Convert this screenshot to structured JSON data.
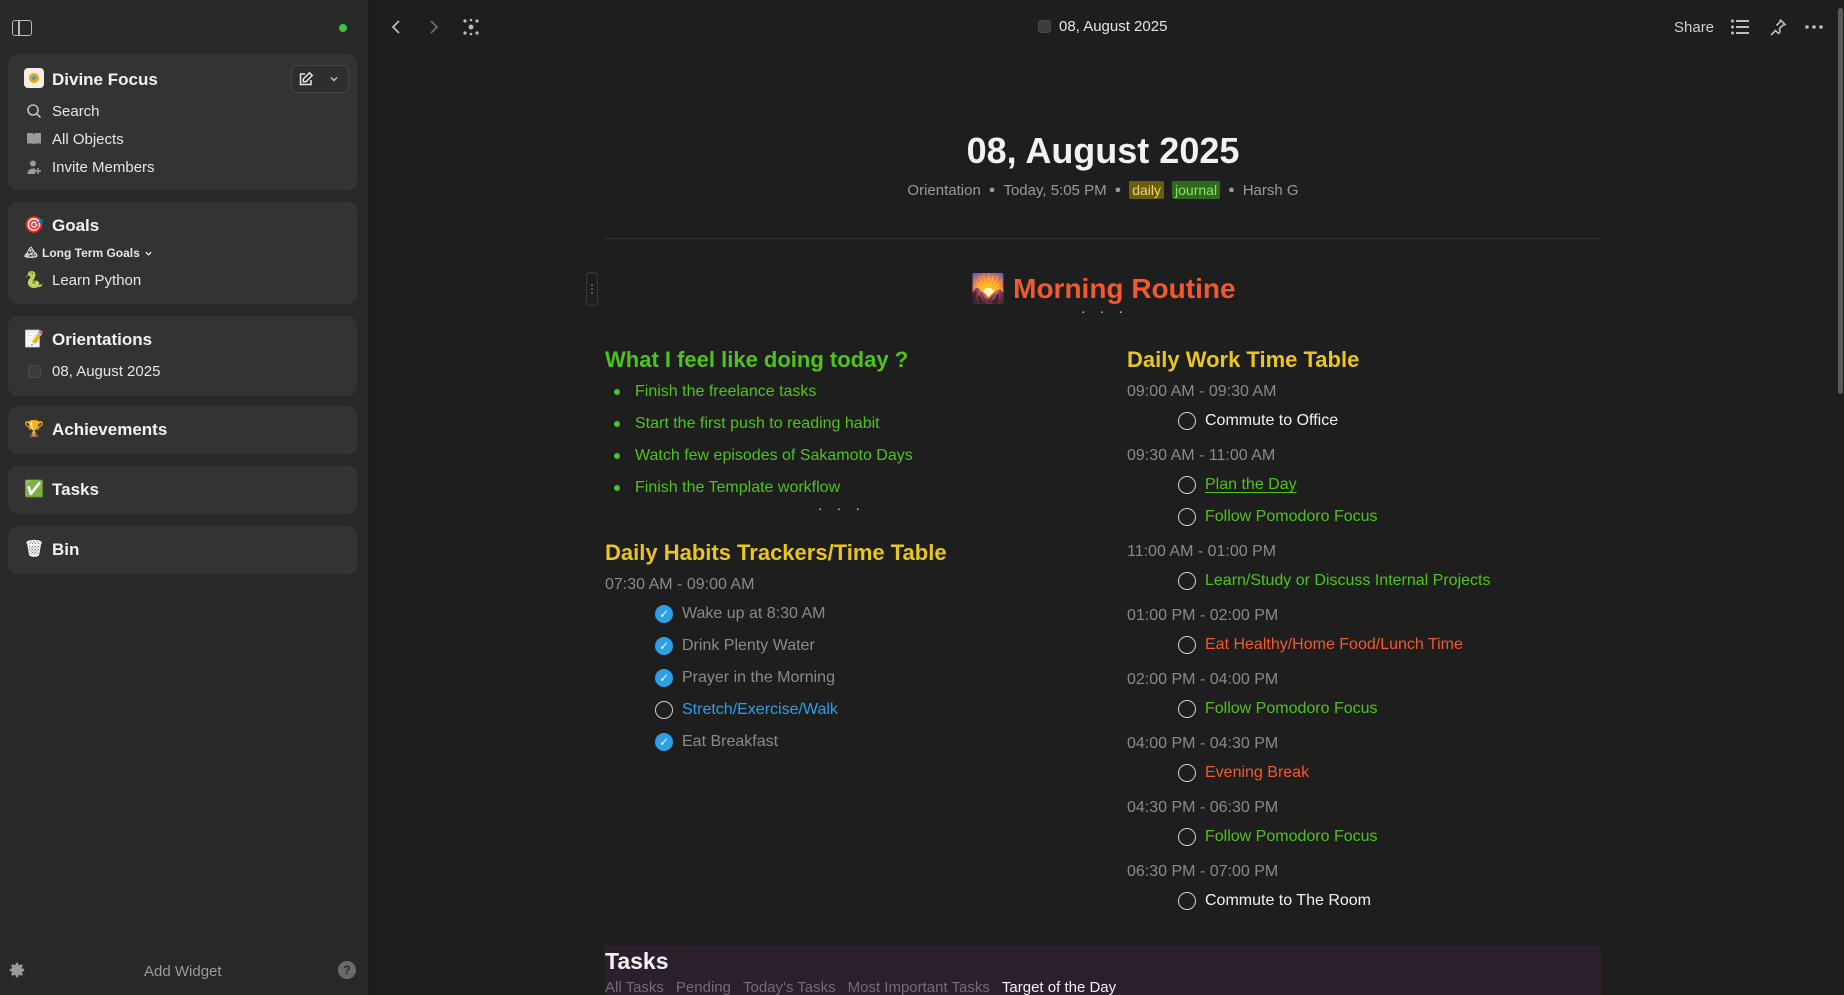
{
  "sidebar": {
    "space": {
      "name": "Divine Focus",
      "icon": "space-logo-icon"
    },
    "menu": [
      {
        "label": "Search",
        "icon": "search-icon"
      },
      {
        "label": "All Objects",
        "icon": "book-icon"
      },
      {
        "label": "Invite Members",
        "icon": "invite-icon"
      }
    ],
    "goals": {
      "title": "Goals",
      "icon": "🎯",
      "sub_label": "Long Term Goals",
      "sub_icon": "🏔",
      "items": [
        {
          "label": "Learn Python",
          "icon": "🐍"
        }
      ]
    },
    "orientations": {
      "title": "Orientations",
      "icon": "📝",
      "items": [
        {
          "label": "08, August 2025"
        }
      ]
    },
    "achievements": {
      "title": "Achievements",
      "icon": "🏆"
    },
    "tasks": {
      "title": "Tasks",
      "icon": "✅"
    },
    "bin": {
      "title": "Bin",
      "icon": "🗑"
    },
    "footer": {
      "add_widget": "Add Widget",
      "help": "?"
    }
  },
  "topbar": {
    "title": "08, August 2025",
    "share": "Share"
  },
  "document": {
    "title": "08, August 2025",
    "meta": {
      "type": "Orientation",
      "time": "Today, 5:05 PM",
      "tags": [
        "daily",
        "journal"
      ],
      "author": "Harsh G"
    },
    "routine_title": "Morning Routine",
    "routine_icon": "🌄",
    "left": {
      "feel_heading": "What I feel like doing today ?",
      "feel_items": [
        "Finish the freelance tasks",
        "Start the first push to reading habit",
        "Watch few episodes of Sakamoto Days",
        "Finish the Template workflow"
      ],
      "habits_heading": "Daily Habits Trackers/Time Table",
      "habits_time": "07:30 AM - 09:00 AM",
      "habits": [
        {
          "label": "Wake up at 8:30 AM",
          "done": true
        },
        {
          "label": "Drink Plenty Water",
          "done": true
        },
        {
          "label": "Prayer in the Morning",
          "done": true
        },
        {
          "label": "Stretch/Exercise/Walk",
          "done": false
        },
        {
          "label": "Eat Breakfast",
          "done": true
        }
      ]
    },
    "right": {
      "heading": "Daily Work Time Table",
      "slots": [
        {
          "time": "09:00 AM - 09:30 AM",
          "items": [
            {
              "label": "Commute to Office"
            }
          ]
        },
        {
          "time": "09:30 AM - 11:00 AM",
          "items": [
            {
              "label": "Plan the Day"
            },
            {
              "label": "Follow Pomodoro Focus"
            }
          ]
        },
        {
          "time": "11:00 AM - 01:00 PM",
          "items": [
            {
              "label": "Learn/Study or Discuss Internal Projects"
            }
          ]
        },
        {
          "time": "01:00 PM - 02:00 PM",
          "items": [
            {
              "label": "Eat Healthy/Home Food/Lunch Time"
            }
          ]
        },
        {
          "time": "02:00 PM - 04:00 PM",
          "items": [
            {
              "label": "Follow Pomodoro Focus"
            }
          ]
        },
        {
          "time": "04:00 PM - 04:30 PM",
          "items": [
            {
              "label": "Evening Break"
            }
          ]
        },
        {
          "time": "04:30 PM - 06:30 PM",
          "items": [
            {
              "label": "Follow Pomodoro Focus"
            }
          ]
        },
        {
          "time": "06:30 PM - 07:00 PM",
          "items": [
            {
              "label": "Commute to The Room"
            }
          ]
        }
      ]
    },
    "tasks_panel": {
      "title": "Tasks",
      "tabs": [
        "All Tasks",
        "Pending",
        "Today's Tasks",
        "Most Important Tasks",
        "Target of the Day"
      ]
    }
  },
  "colors": {
    "accent_green": "#4fc31c",
    "accent_yellow": "#e8c520",
    "accent_orange": "#f05a2c",
    "accent_blue": "#2f9ee8",
    "sync_green": "#3ec23e"
  }
}
